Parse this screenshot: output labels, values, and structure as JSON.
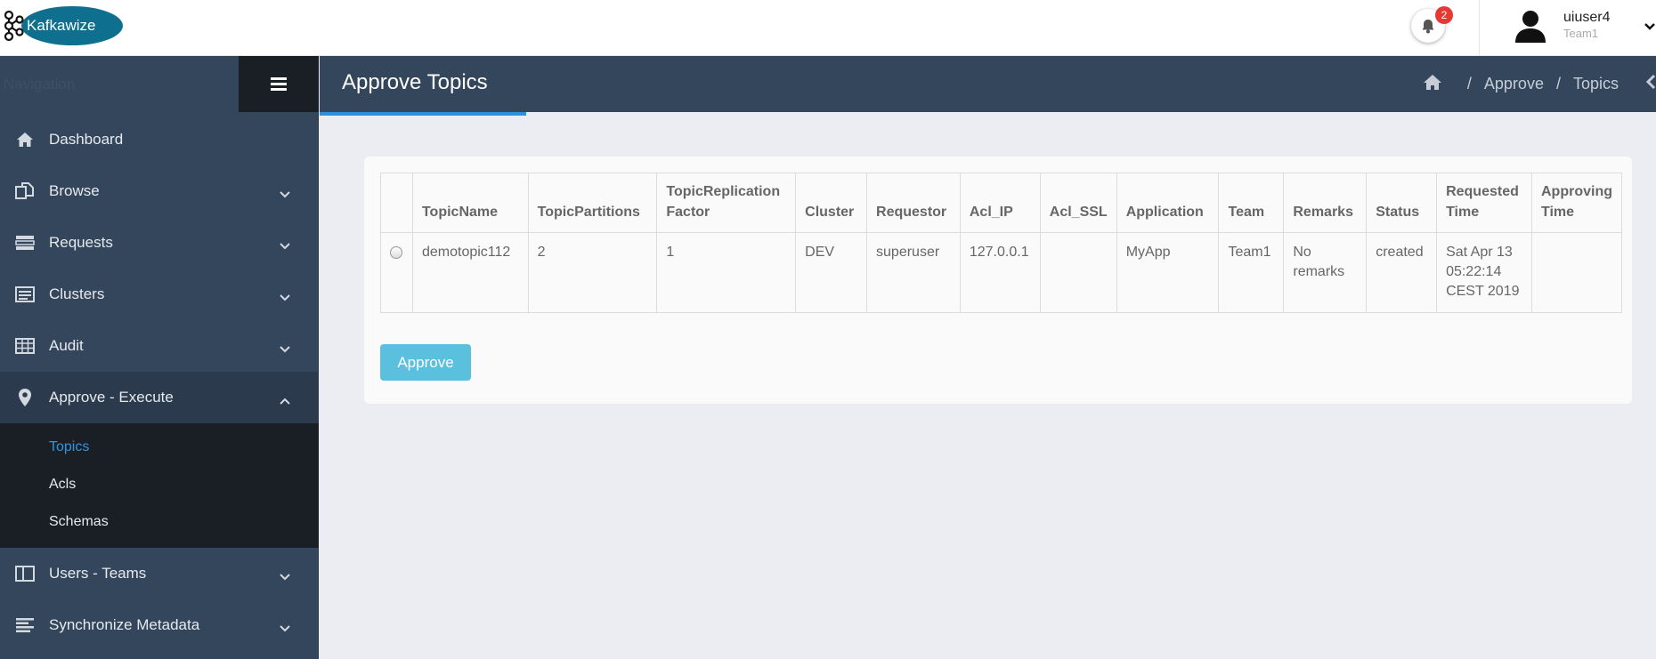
{
  "app": {
    "logo_text": "Kafkawize"
  },
  "header": {
    "notification_count": "2",
    "user_name": "uiuser4",
    "user_team": "Team1"
  },
  "sidebar": {
    "nav_label": "Navigation",
    "items": [
      {
        "label": "Dashboard",
        "icon": "home-icon"
      },
      {
        "label": "Browse",
        "icon": "copy-icon"
      },
      {
        "label": "Requests",
        "icon": "list-icon"
      },
      {
        "label": "Clusters",
        "icon": "server-icon"
      },
      {
        "label": "Audit",
        "icon": "table-icon"
      },
      {
        "label": "Approve - Execute",
        "icon": "map-pin-icon"
      },
      {
        "label": "Users - Teams",
        "icon": "columns-icon"
      },
      {
        "label": "Synchronize Metadata",
        "icon": "align-left-icon"
      }
    ],
    "approve_sub": [
      "Topics",
      "Acls",
      "Schemas"
    ]
  },
  "page": {
    "title": "Approve Topics",
    "breadcrumb": [
      "Approve",
      "Topics"
    ]
  },
  "table": {
    "headers": [
      "TopicName",
      "TopicPartitions",
      "TopicReplication Factor",
      "Cluster",
      "Requestor",
      "Acl_IP",
      "Acl_SSL",
      "Application",
      "Team",
      "Remarks",
      "Status",
      "Requested Time",
      "Approving Time"
    ],
    "rows": [
      [
        "demotopic112",
        "2",
        "1",
        "DEV",
        "superuser",
        "127.0.0.1",
        "",
        "MyApp",
        "Team1",
        "No remarks",
        "created",
        "Sat Apr 13 05:22:14 CEST 2019",
        ""
      ]
    ]
  },
  "actions": {
    "approve_label": "Approve"
  },
  "colors": {
    "sidebar_bg": "#34465c",
    "submenu_bg": "#1a1f26",
    "accent": "#2f95dc",
    "button": "#5bc0de",
    "badge": "#e53935"
  }
}
